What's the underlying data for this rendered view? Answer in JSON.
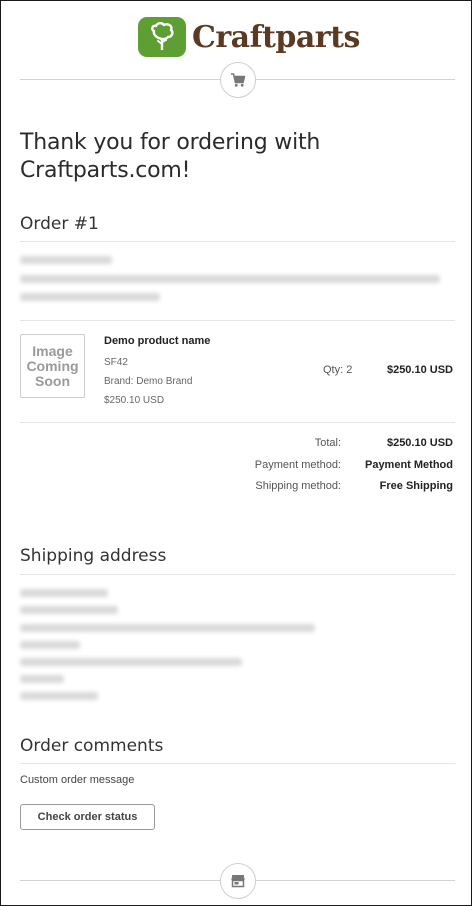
{
  "brand": {
    "name": "Craftparts",
    "logo_icon": "tree-icon",
    "colors": {
      "green": "#5e9f33",
      "brown": "#5b3a23"
    }
  },
  "header_icon": "shopping-cart-icon",
  "footer_icon": "store-icon",
  "thanks": "Thank you for ordering with Craftparts.com!",
  "order": {
    "title": "Order #1",
    "item": {
      "image_text": [
        "Image",
        "Coming",
        "Soon"
      ],
      "name": "Demo product name",
      "sku": "SF42",
      "brand": "Brand: Demo Brand",
      "unit_price": "$250.10 USD",
      "qty": "Qty: 2",
      "total": "$250.10 USD"
    },
    "summary": [
      {
        "label": "Total:",
        "value": "$250.10 USD"
      },
      {
        "label": "Payment method:",
        "value": "Payment Method"
      },
      {
        "label": "Shipping method:",
        "value": "Free Shipping"
      }
    ]
  },
  "shipping": {
    "title": "Shipping address"
  },
  "comments": {
    "title": "Order comments",
    "text": "Custom order message"
  },
  "button": {
    "label": "Check order status"
  }
}
